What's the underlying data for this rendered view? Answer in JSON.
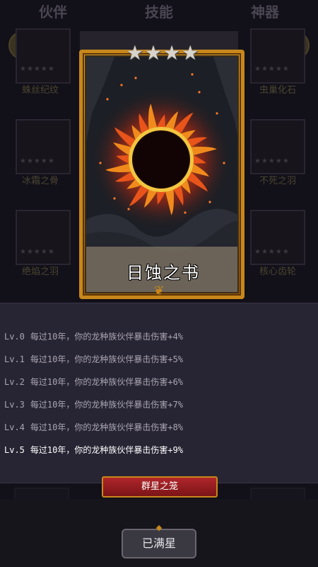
{
  "background": {
    "tabs": [
      "伙伴",
      "技能",
      "神器"
    ],
    "left_items": [
      "蛛丝纪纹",
      "冰霜之骨",
      "绝焰之羽"
    ],
    "right_items": [
      "虫巢化石",
      "不死之羽",
      "核心齿轮"
    ]
  },
  "card": {
    "name": "日蚀之书",
    "stars": 4,
    "star_glyph": "★"
  },
  "effects": [
    {
      "level": "Lv.0",
      "text": "每过10年，你的龙种族伙伴暴击伤害+4%"
    },
    {
      "level": "Lv.1",
      "text": "每过10年，你的龙种族伙伴暴击伤害+5%"
    },
    {
      "level": "Lv.2",
      "text": "每过10年，你的龙种族伙伴暴击伤害+6%"
    },
    {
      "level": "Lv.3",
      "text": "每过10年，你的龙种族伙伴暴击伤害+7%"
    },
    {
      "level": "Lv.4",
      "text": "每过10年，你的龙种族伙伴暴击伤害+8%"
    },
    {
      "level": "Lv.5",
      "text": "每过10年，你的龙种族伙伴暴击伤害+9%"
    }
  ],
  "active_level_index": 5,
  "collection_name": "群星之笼",
  "maxed_label": "已满星",
  "colors": {
    "frame_gold": "#c8871b",
    "banner_red": "#b0262a",
    "eclipse_fire": "#e8541a"
  }
}
